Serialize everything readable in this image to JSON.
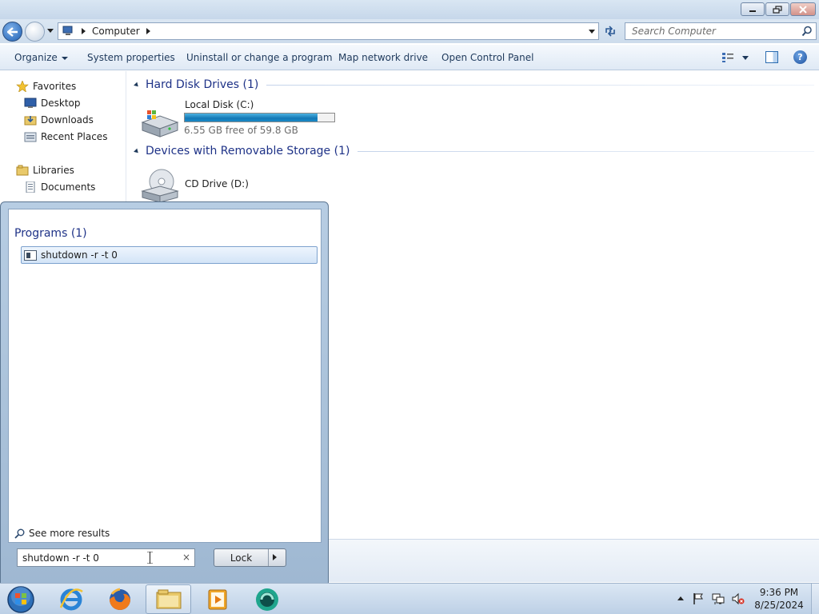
{
  "window": {
    "address": {
      "crumb": "Computer"
    },
    "search": {
      "placeholder": "Search Computer"
    },
    "toolbar": {
      "organize": "Organize",
      "system_properties": "System properties",
      "uninstall": "Uninstall or change a program",
      "map_drive": "Map network drive",
      "control_panel": "Open Control Panel"
    },
    "nav": {
      "favorites": "Favorites",
      "desktop": "Desktop",
      "downloads": "Downloads",
      "recent_places": "Recent Places",
      "libraries": "Libraries",
      "documents": "Documents"
    },
    "groups": {
      "hard_disks": "Hard Disk Drives (1)",
      "removable": "Devices with Removable Storage (1)"
    },
    "drives": {
      "c": {
        "name": "Local Disk (C:)",
        "free": "6.55 GB free of 59.8 GB",
        "used_fraction": 0.89
      },
      "d": {
        "name": "CD Drive (D:)"
      }
    }
  },
  "start_menu": {
    "programs_title": "Programs (1)",
    "result": "shutdown -r -t 0",
    "see_more": "See more results",
    "search_value": "shutdown -r -t 0",
    "clear": "×",
    "power_label": "Lock"
  },
  "taskbar": {
    "time": "9:36 PM",
    "date": "8/25/2024"
  },
  "colors": {
    "accent": "#1e3287",
    "selection": "#d3e4f7",
    "taskbar": "#c8d9ec"
  },
  "icons": {
    "start": "windows-orb-icon",
    "ie": "internet-explorer-icon",
    "firefox": "firefox-icon",
    "explorer": "folder-icon",
    "media": "media-player-icon",
    "app": "green-circle-app-icon"
  }
}
